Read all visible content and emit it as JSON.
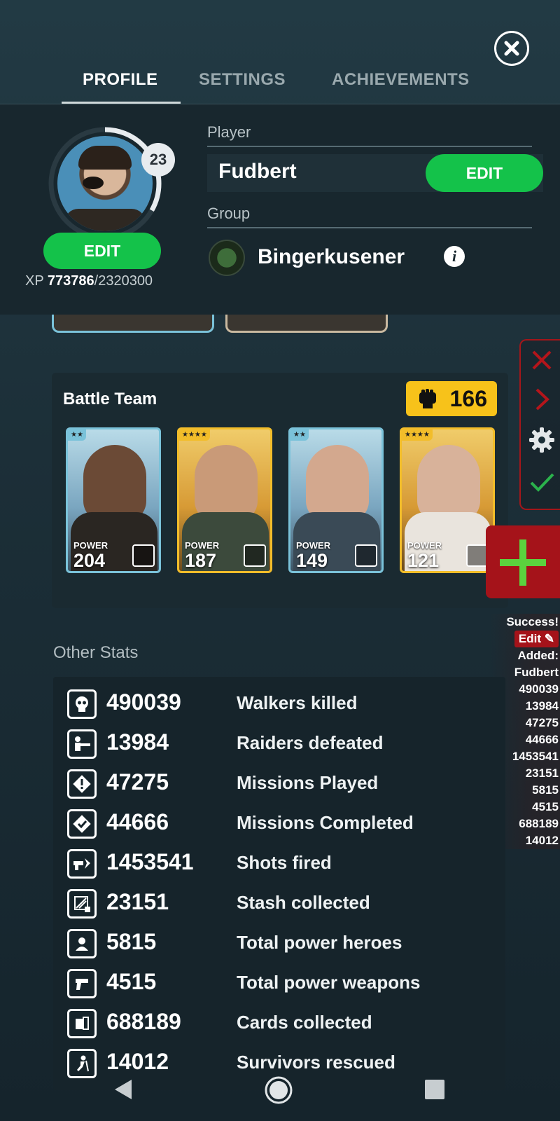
{
  "tabs": [
    {
      "label": "PROFILE",
      "active": true
    },
    {
      "label": "SETTINGS",
      "active": false
    },
    {
      "label": "ACHIEVEMENTS",
      "active": false
    }
  ],
  "profile": {
    "level": "23",
    "edit_avatar_label": "EDIT",
    "xp_prefix": "XP",
    "xp_current": "773786",
    "xp_total": "/2320300",
    "player_label": "Player",
    "player_name": "Fudbert",
    "edit_name_label": "EDIT",
    "group_label": "Group",
    "group_name": "Bingerkusener"
  },
  "battle_team": {
    "title": "Battle Team",
    "total_power": "166",
    "power_label": "POWER",
    "heroes": [
      {
        "stars": "★★",
        "power": "204",
        "rarity": "blue"
      },
      {
        "stars": "★★★★",
        "power": "187",
        "rarity": "gold"
      },
      {
        "stars": "★★",
        "power": "149",
        "rarity": "blue"
      },
      {
        "stars": "★★★★",
        "power": "121",
        "rarity": "gold"
      }
    ]
  },
  "overlay": {
    "success": "Success!",
    "edit": "Edit",
    "added": "Added:",
    "lines": [
      "Fudbert",
      "490039",
      "13984",
      "47275",
      "44666",
      "1453541",
      "23151",
      "5815",
      "4515",
      "688189",
      "14012"
    ]
  },
  "other_stats": {
    "title": "Other Stats",
    "rows": [
      {
        "icon": "skull-icon",
        "value": "490039",
        "label": "Walkers killed"
      },
      {
        "icon": "raider-icon",
        "value": "13984",
        "label": "Raiders defeated"
      },
      {
        "icon": "mission-alert-icon",
        "value": "47275",
        "label": "Missions Played"
      },
      {
        "icon": "mission-check-icon",
        "value": "44666",
        "label": "Missions Completed"
      },
      {
        "icon": "shot-icon",
        "value": "1453541",
        "label": "Shots fired"
      },
      {
        "icon": "stash-icon",
        "value": "23151",
        "label": "Stash collected"
      },
      {
        "icon": "hero-icon",
        "value": "5815",
        "label": "Total power heroes"
      },
      {
        "icon": "weapon-icon",
        "value": "4515",
        "label": "Total power weapons"
      },
      {
        "icon": "cards-icon",
        "value": "688189",
        "label": "Cards collected"
      },
      {
        "icon": "survivor-icon",
        "value": "14012",
        "label": "Survivors rescued"
      }
    ]
  },
  "colors": {
    "accent_green": "#14c24a",
    "power_yellow": "#f7c21a",
    "overlay_red": "#a5131a",
    "background": "#1c2f38"
  }
}
